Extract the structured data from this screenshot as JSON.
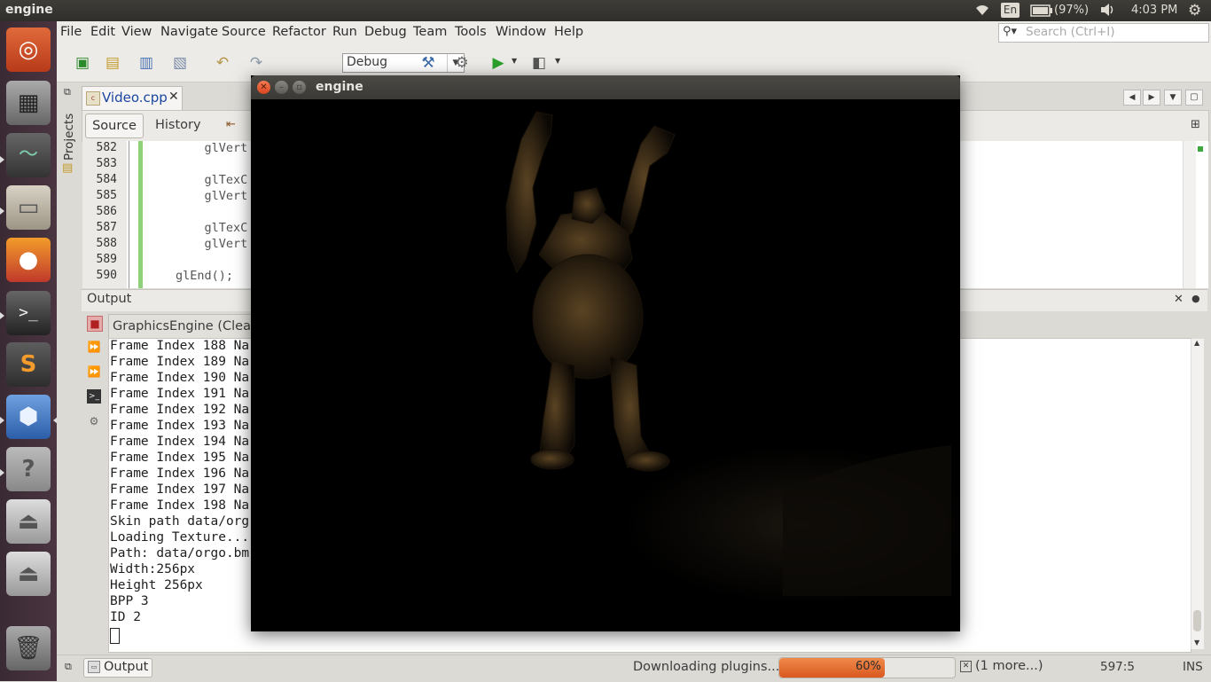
{
  "topbar": {
    "app_title": "engine",
    "keyboard": "En",
    "battery": "(97%)",
    "clock": "4:03 PM"
  },
  "menu": {
    "items": [
      "File",
      "Edit",
      "View",
      "Navigate",
      "Source",
      "Refactor",
      "Run",
      "Debug",
      "Team",
      "Tools",
      "Window",
      "Help"
    ]
  },
  "search": {
    "placeholder": "Search (Ctrl+I)"
  },
  "toolbar": {
    "configuration": "Debug"
  },
  "side_tabs": {
    "projects": "Projects"
  },
  "editor": {
    "file_tab": "Video.cpp",
    "source_tab": "Source",
    "history_tab": "History",
    "line_numbers": [
      "582",
      "583",
      "584",
      "585",
      "586",
      "587",
      "588",
      "589",
      "590"
    ],
    "lines": [
      "    glVert",
      "",
      "    glTexC",
      "    glVert",
      "",
      "    glTexC",
      "    glVert",
      "",
      "glEnd();"
    ]
  },
  "output": {
    "panel_title": "Output",
    "run_tab": "GraphicsEngine (Clean",
    "lines": [
      "Frame Index 188 Na",
      "Frame Index 189 Na",
      "Frame Index 190 Na",
      "Frame Index 191 Na",
      "Frame Index 192 Na",
      "Frame Index 193 Na",
      "Frame Index 194 Na",
      "Frame Index 195 Na",
      "Frame Index 196 Na",
      "Frame Index 197 Na",
      "Frame Index 198 Na",
      "Skin path data/org",
      "Loading Texture...",
      "Path: data/orgo.bm",
      "Width:256px",
      "Height 256px",
      "BPP 3",
      "ID 2"
    ]
  },
  "statusbar": {
    "output_button": "Output",
    "task": "Downloading plugins...",
    "progress_label": "60%",
    "progress_fraction": 0.6,
    "more": "(1 more...)",
    "caret": "597:5",
    "mode": "INS"
  },
  "engine_window": {
    "title": "engine"
  },
  "colors": {
    "launcher": "#3a2a33",
    "progress": "#e8702f",
    "fold_marker": "#8fd17a"
  }
}
